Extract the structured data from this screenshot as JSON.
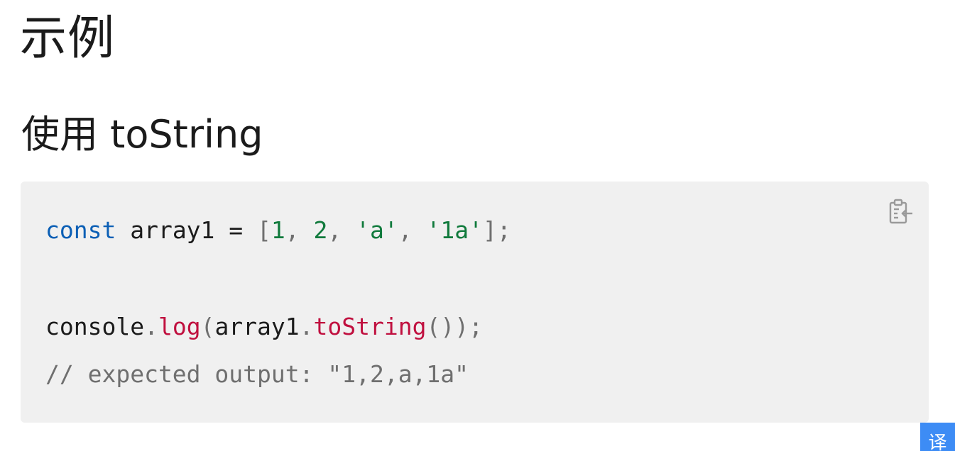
{
  "page": {
    "title": "示例",
    "section_heading": "使用 toString"
  },
  "code_block": {
    "copy_icon": "clipboard-copy-icon",
    "line_1": {
      "keyword": "const",
      "variable": " array1 = ",
      "open_bracket": "[",
      "n1": "1",
      "sep1": ", ",
      "n2": "2",
      "sep2": ", ",
      "s1": "'a'",
      "sep3": ", ",
      "s2": "'1a'",
      "close": "];"
    },
    "line_2": {
      "object": "console",
      "dot1": ".",
      "method1": "log",
      "paren_open": "(",
      "arg_object": "array1",
      "dot2": ".",
      "method2": "toString",
      "paren_close": "());"
    },
    "line_3": {
      "comment": "// expected output: \"1,2,a,1a\""
    }
  },
  "floating": {
    "translate_label": "译"
  },
  "colors": {
    "keyword": "#0b5fb5",
    "number_and_string": "#107a3c",
    "function": "#c0103f",
    "punctuation": "#6f6f6f",
    "code_background": "#f0f0f0",
    "translate_button": "#3d8cf5"
  }
}
